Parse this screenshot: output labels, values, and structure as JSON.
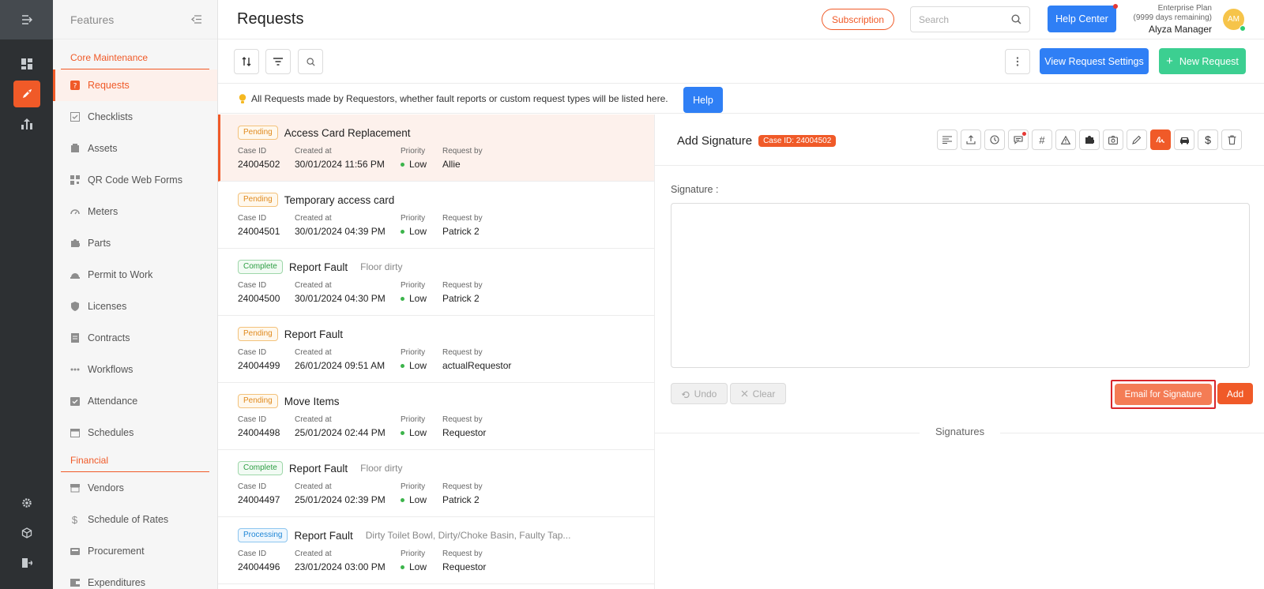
{
  "rail": {
    "top_icon": "menu-collapse-icon",
    "items": [
      {
        "icon": "dashboard-icon",
        "active": false
      },
      {
        "icon": "rocket-icon",
        "active": true
      },
      {
        "icon": "chart-icon",
        "active": false
      }
    ],
    "bottom_items": [
      {
        "icon": "gear-icon"
      },
      {
        "icon": "cube-icon"
      },
      {
        "icon": "logout-icon"
      }
    ]
  },
  "sidebar": {
    "title": "Features",
    "sections": [
      {
        "label": "Core Maintenance",
        "items": [
          {
            "label": "Requests",
            "icon": "request-icon",
            "active": true
          },
          {
            "label": "Checklists",
            "icon": "checklist-icon"
          },
          {
            "label": "Assets",
            "icon": "asset-icon"
          },
          {
            "label": "QR Code Web Forms",
            "icon": "qr-icon"
          },
          {
            "label": "Meters",
            "icon": "meter-icon"
          },
          {
            "label": "Parts",
            "icon": "puzzle-icon"
          },
          {
            "label": "Permit to Work",
            "icon": "helmet-icon"
          },
          {
            "label": "Licenses",
            "icon": "shield-icon"
          },
          {
            "label": "Contracts",
            "icon": "contract-icon"
          },
          {
            "label": "Workflows",
            "icon": "workflow-icon"
          },
          {
            "label": "Attendance",
            "icon": "attendance-icon"
          },
          {
            "label": "Schedules",
            "icon": "calendar-icon"
          }
        ]
      },
      {
        "label": "Financial",
        "items": [
          {
            "label": "Vendors",
            "icon": "store-icon"
          },
          {
            "label": "Schedule of Rates",
            "icon": "dollar-icon"
          },
          {
            "label": "Procurement",
            "icon": "procurement-icon"
          },
          {
            "label": "Expenditures",
            "icon": "expenditure-icon"
          }
        ]
      }
    ]
  },
  "header": {
    "title": "Requests",
    "subscription_label": "Subscription",
    "search_placeholder": "Search",
    "help_center_label": "Help Center",
    "plan_name": "Enterprise Plan",
    "plan_remaining": "(9999 days remaining)",
    "user_name": "Alyza Manager",
    "avatar_initials": "AM"
  },
  "toolbar": {
    "view_settings_label": "View Request Settings",
    "new_request_label": "New Request"
  },
  "info": {
    "text": "All Requests made by Requestors, whether fault reports or custom request types will be listed here.",
    "help_label": "Help"
  },
  "list_labels": {
    "case_id": "Case ID",
    "created_at": "Created at",
    "priority": "Priority",
    "request_by": "Request by"
  },
  "requests": [
    {
      "status": "Pending",
      "status_class": "pending",
      "title": "Access Card Replacement",
      "tags": "",
      "case_id": "24004502",
      "created_at": "30/01/2024 11:56 PM",
      "priority": "Low",
      "request_by": "Allie",
      "active": true
    },
    {
      "status": "Pending",
      "status_class": "pending",
      "title": "Temporary access card",
      "tags": "",
      "case_id": "24004501",
      "created_at": "30/01/2024 04:39 PM",
      "priority": "Low",
      "request_by": "Patrick 2"
    },
    {
      "status": "Complete",
      "status_class": "complete",
      "title": "Report Fault",
      "tags": "Floor    dirty",
      "case_id": "24004500",
      "created_at": "30/01/2024 04:30 PM",
      "priority": "Low",
      "request_by": "Patrick 2"
    },
    {
      "status": "Pending",
      "status_class": "pending",
      "title": "Report Fault",
      "tags": "",
      "case_id": "24004499",
      "created_at": "26/01/2024 09:51 AM",
      "priority": "Low",
      "request_by": "actualRequestor"
    },
    {
      "status": "Pending",
      "status_class": "pending",
      "title": "Move Items",
      "tags": "",
      "case_id": "24004498",
      "created_at": "25/01/2024 02:44 PM",
      "priority": "Low",
      "request_by": "Requestor"
    },
    {
      "status": "Complete",
      "status_class": "complete",
      "title": "Report Fault",
      "tags": "Floor    dirty",
      "case_id": "24004497",
      "created_at": "25/01/2024 02:39 PM",
      "priority": "Low",
      "request_by": "Patrick 2"
    },
    {
      "status": "Processing",
      "status_class": "processing",
      "title": "Report Fault",
      "tags": "Dirty Toilet Bowl, Dirty/Choke Basin, Faulty Tap...",
      "case_id": "24004496",
      "created_at": "23/01/2024 03:00 PM",
      "priority": "Low",
      "request_by": "Requestor"
    }
  ],
  "detail": {
    "title": "Add Signature",
    "case_badge": "Case ID: 24004502",
    "signature_label": "Signature :",
    "undo_label": "Undo",
    "clear_label": "Clear",
    "email_label": "Email for Signature",
    "add_label": "Add",
    "signatures_title": "Signatures"
  },
  "colors": {
    "accent": "#f05a28",
    "primary_blue": "#2f7ff5",
    "success_green": "#3ccf91"
  }
}
